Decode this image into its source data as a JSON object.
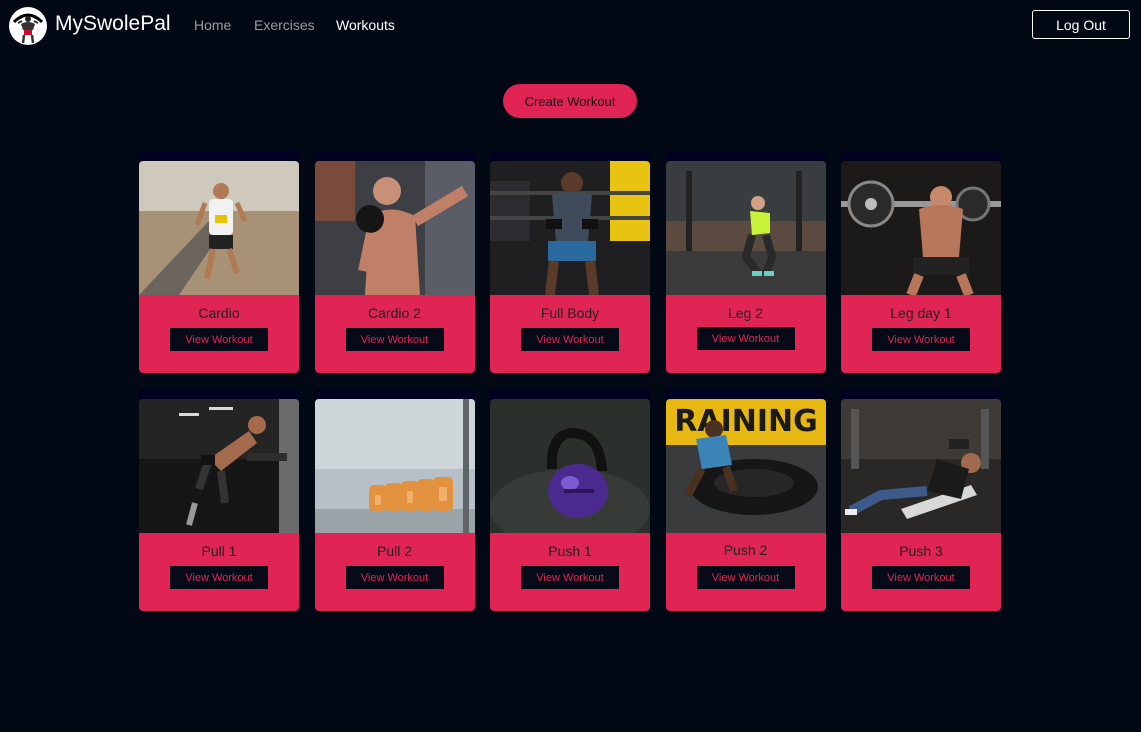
{
  "app": {
    "brand": "MySwolePal",
    "logo_icon": "bodybuilder-logo-icon"
  },
  "nav": {
    "links": [
      {
        "label": "Home",
        "active": false
      },
      {
        "label": "Exercises",
        "active": false
      },
      {
        "label": "Workouts",
        "active": true
      }
    ],
    "logout_label": "Log Out"
  },
  "actions": {
    "create_label": "Create Workout"
  },
  "workouts": [
    {
      "title": "Cardio",
      "button": "View Workout"
    },
    {
      "title": "Cardio 2",
      "button": "View Workout"
    },
    {
      "title": "Full Body",
      "button": "View Workout"
    },
    {
      "title": "Leg 2",
      "button": "View Workout"
    },
    {
      "title": "Leg day 1",
      "button": "View Workout"
    },
    {
      "title": "Pull 1",
      "button": "View Workout"
    },
    {
      "title": "Pull 2",
      "button": "View Workout"
    },
    {
      "title": "Push 1",
      "button": "View Workout"
    },
    {
      "title": "Push 2",
      "button": "View Workout"
    },
    {
      "title": "Push 3",
      "button": "View Workout"
    }
  ],
  "colors": {
    "background": "#030914",
    "accent": "#e02453",
    "card_button": "#070b18"
  }
}
